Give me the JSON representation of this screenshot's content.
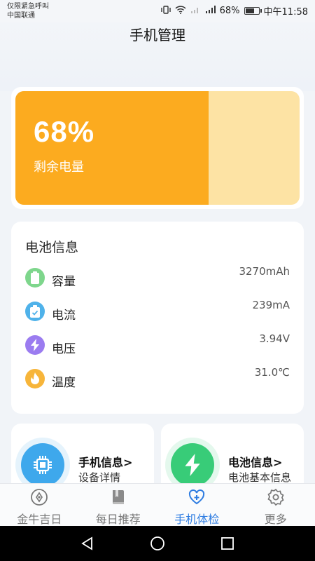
{
  "status_bar": {
    "carrier_line1": "仅限紧急呼叫",
    "carrier_line2": "中国联通",
    "battery_text": "68%",
    "battery_level": 0.68,
    "time": "中午11:58"
  },
  "header": {
    "title": "手机管理"
  },
  "battery": {
    "percent_text": "68%",
    "percent": 68,
    "label": "剩余电量",
    "colors": {
      "fill": "#fcab1f",
      "track": "#fde3a4"
    }
  },
  "battery_info": {
    "title": "电池信息",
    "rows": [
      {
        "icon": "battery-icon",
        "label": "容量",
        "value": "3270mAh",
        "color": "#7ed68c",
        "bg": "#def5e2"
      },
      {
        "icon": "clipboard-icon",
        "label": "电流",
        "value": "239mA",
        "color": "#4fb2ea",
        "bg": "#dcefff"
      },
      {
        "icon": "lightning-icon",
        "label": "电压",
        "value": "3.94V",
        "color": "#9b7cf0",
        "bg": "#e9e2ff"
      },
      {
        "icon": "flame-icon",
        "label": "温度",
        "value": "31.0℃",
        "color": "#f7b53a",
        "bg": "#fdebc8"
      }
    ]
  },
  "shortcuts": [
    {
      "icon": "chip-icon",
      "title": "手机信息>",
      "subtitle": "设备详情",
      "color": "#3ea8ec"
    },
    {
      "icon": "lightning-icon",
      "title": "电池信息>",
      "subtitle": "电池基本信息",
      "color": "#38cc78"
    }
  ],
  "tabs": [
    {
      "icon": "compass-icon",
      "label": "金牛吉日",
      "active": false
    },
    {
      "icon": "book-icon",
      "label": "每日推荐",
      "active": false
    },
    {
      "icon": "heart-plus-icon",
      "label": "手机体检",
      "active": true
    },
    {
      "icon": "gear-icon",
      "label": "更多",
      "active": false
    }
  ],
  "accent_color": "#2f7de1"
}
